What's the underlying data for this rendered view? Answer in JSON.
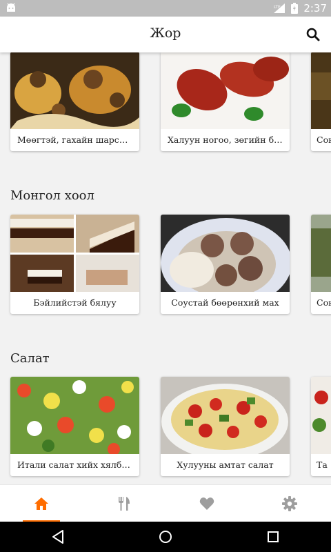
{
  "status_bar": {
    "network": "LTE",
    "time": "2:37"
  },
  "app_bar": {
    "title": "Жор",
    "search_icon": "search-icon"
  },
  "sections": [
    {
      "title": "",
      "cards": [
        {
          "label": "Мөөгтэй, гахайн шарсан мах"
        },
        {
          "label": "Халуун ногоо, зөгийн бал"
        },
        {
          "label": "Сон"
        }
      ]
    },
    {
      "title": "Монгол хоол",
      "cards": [
        {
          "label": "Бэйлийстэй бялуу"
        },
        {
          "label": "Соустай бөөрөнхий мах"
        },
        {
          "label": "Сон"
        }
      ]
    },
    {
      "title": "Салат",
      "cards": [
        {
          "label": "Итали салат хийх хялбар арга"
        },
        {
          "label": "Хулууны амтат салат"
        },
        {
          "label": "Та"
        }
      ]
    }
  ],
  "bottom_nav": [
    {
      "icon": "home-icon",
      "active": true
    },
    {
      "icon": "fork-knife-icon",
      "active": false
    },
    {
      "icon": "heart-icon",
      "active": false
    },
    {
      "icon": "gear-icon",
      "active": false
    }
  ],
  "colors": {
    "accent": "#ff6d00",
    "inactive_icon": "#9e9e9e",
    "status_bar": "#bdbdbd"
  }
}
